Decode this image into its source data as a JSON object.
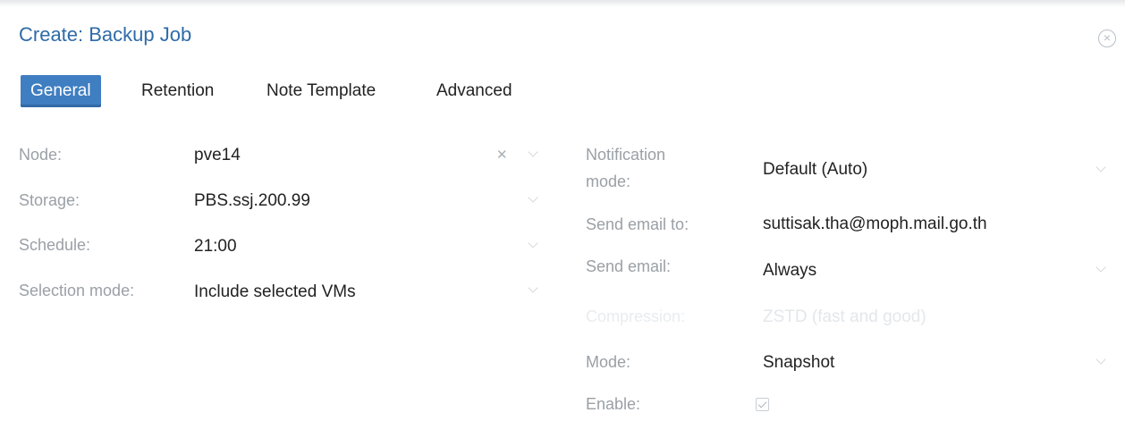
{
  "window": {
    "title": "Create: Backup Job"
  },
  "tabs": [
    {
      "label": "General",
      "active": true
    },
    {
      "label": "Retention"
    },
    {
      "label": "Note Template"
    },
    {
      "label": "Advanced"
    }
  ],
  "left": {
    "node": {
      "label": "Node:",
      "value": "pve14"
    },
    "storage": {
      "label": "Storage:",
      "value": "PBS.ssj.200.99"
    },
    "schedule": {
      "label": "Schedule:",
      "value": "21:00"
    },
    "selection_mode": {
      "label": "Selection mode:",
      "value": "Include selected VMs"
    }
  },
  "right": {
    "notification_mode": {
      "label_line1": "Notification",
      "label_line2": "mode:",
      "value": "Default (Auto)"
    },
    "send_email_to": {
      "label": "Send email to:",
      "value": "suttisak.tha@moph.mail.go.th"
    },
    "send_email": {
      "label": "Send email:",
      "value": "Always"
    },
    "compression": {
      "label": "Compression:",
      "value": "ZSTD (fast and good)"
    },
    "mode": {
      "label": "Mode:",
      "value": "Snapshot"
    },
    "enable": {
      "label": "Enable:",
      "checked": true
    }
  },
  "colors": {
    "accent": "#3f7ec1",
    "title": "#2f6ba8",
    "label": "#9aa0a6"
  },
  "icons": {
    "close": "close-circle-icon",
    "clear": "clear-x-icon",
    "dropdown": "chevron-down-icon",
    "checkbox": "checkbox-checked-icon"
  }
}
